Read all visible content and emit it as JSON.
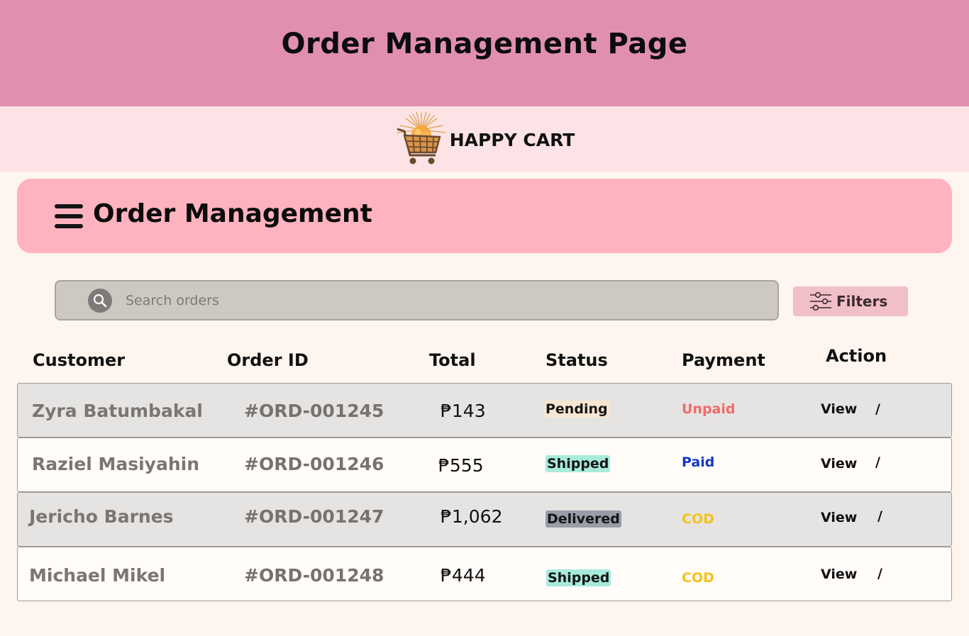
{
  "page_title": "Order Management Page",
  "brand": {
    "name": "HAPPY CART"
  },
  "section": {
    "title": "Order Management"
  },
  "search": {
    "placeholder": "Search orders"
  },
  "filters": {
    "label": "Filters"
  },
  "columns": {
    "customer": "Customer",
    "order_id": "Order ID",
    "total": "Total",
    "status": "Status",
    "payment": "Payment",
    "action": "Action"
  },
  "orders": [
    {
      "customer": "Zyra Batumbakal",
      "order_id": "#ORD-001245",
      "total": "₱143",
      "status": "Pending",
      "payment": "Unpaid",
      "view": "View",
      "sep": "/"
    },
    {
      "customer": "Raziel Masiyahin",
      "order_id": "#ORD-001246",
      "total": "₱555",
      "status": "Shipped",
      "payment": "Paid",
      "view": "View",
      "sep": "/"
    },
    {
      "customer": "Jericho Barnes",
      "order_id": "#ORD-001247",
      "total": "₱1,062",
      "status": "Delivered",
      "payment": "COD",
      "view": "View",
      "sep": "/"
    },
    {
      "customer": "Michael Mikel",
      "order_id": "#ORD-001248",
      "total": "₱444",
      "status": "Shipped",
      "payment": "COD",
      "view": "View",
      "sep": "/"
    }
  ],
  "colors": {
    "banner": "#e18fb1",
    "brand_bar": "#fee3e6",
    "section_header": "#ffb3bf",
    "status_pending": "#f7e6d2",
    "status_shipped": "#a8ebdc",
    "status_delivered": "#9a9ca8",
    "payment_unpaid": "#f06a6a",
    "payment_paid": "#1537c4",
    "payment_cod": "#f4c21b"
  },
  "icons": {
    "menu": "hamburger-menu-icon",
    "search": "search-icon",
    "filters": "sliders-icon",
    "logo": "shopping-cart-logo"
  }
}
